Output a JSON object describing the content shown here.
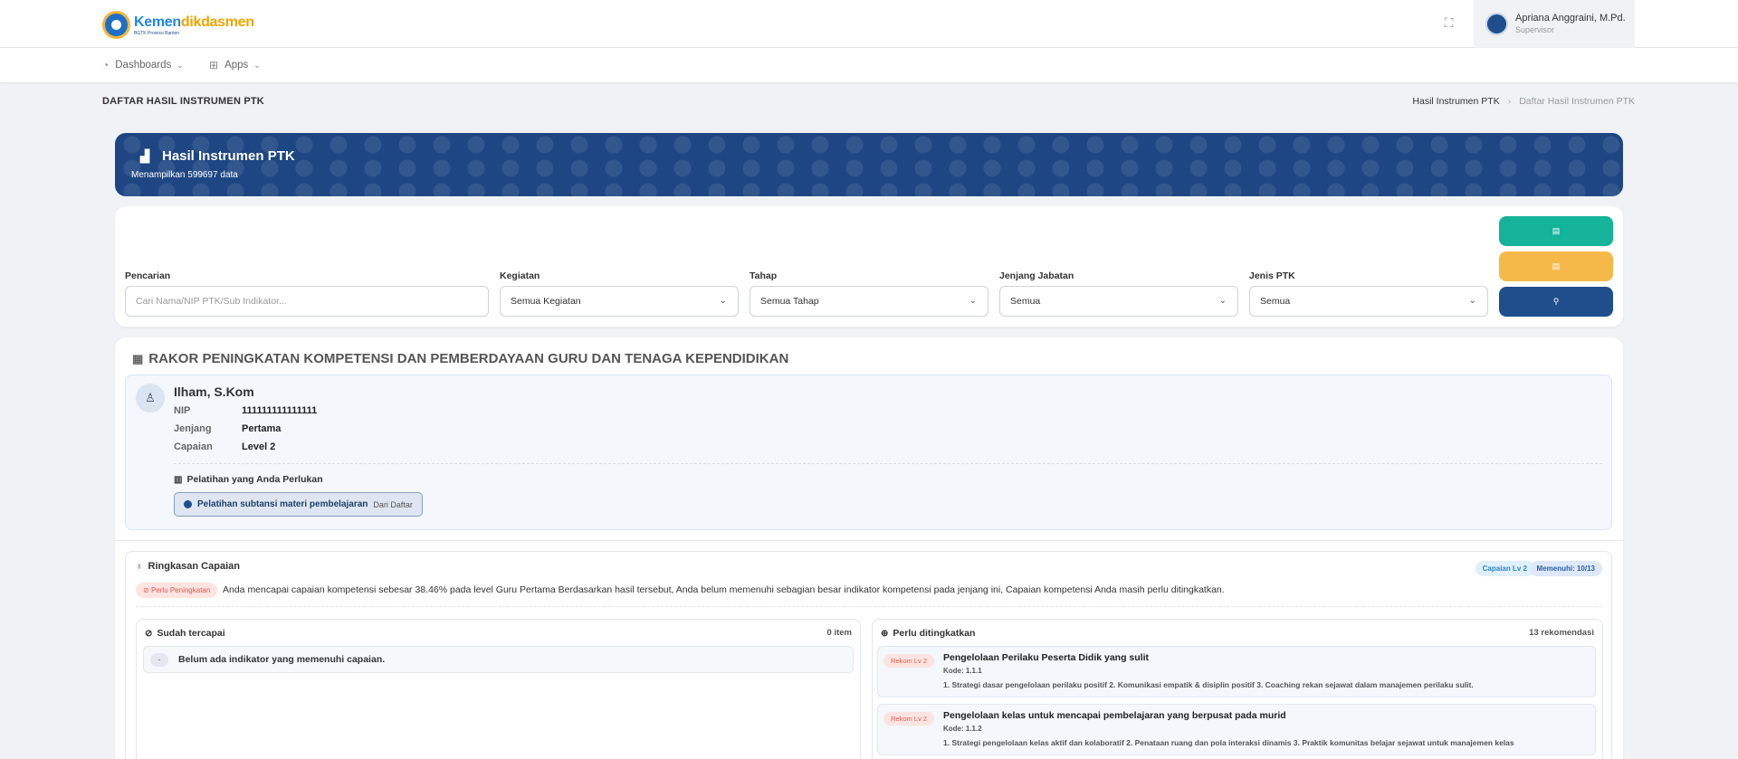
{
  "brand": {
    "name_a": "Kemen",
    "name_b": "dikdasmen",
    "subtitle": "BGTK Provinsi Banten"
  },
  "user": {
    "name": "Apriana Anggraini, M.Pd.",
    "role": "Supervisor"
  },
  "nav": {
    "dashboards": "Dashboards",
    "apps": "Apps"
  },
  "page": {
    "title": "DAFTAR HASIL INSTRUMEN PTK"
  },
  "breadcrumb": {
    "item1": "Hasil Instrumen PTK",
    "item2": "Daftar Hasil Instrumen PTK"
  },
  "hero": {
    "title": "Hasil Instrumen PTK",
    "subtitle": "Menampilkan 599697 data"
  },
  "filters": {
    "search_label": "Pencarian",
    "search_placeholder": "Cari Nama/NIP PTK/Sub Indikator...",
    "kegiatan_label": "Kegiatan",
    "kegiatan_value": "Semua Kegiatan",
    "tahap_label": "Tahap",
    "tahap_value": "Semua Tahap",
    "jenjang_label": "Jenjang Jabatan",
    "jenjang_value": "Semua",
    "jenis_label": "Jenis PTK",
    "jenis_value": "Semua"
  },
  "colors": {
    "btn_excel": "#14b39a",
    "btn_pdf": "#f5b94a",
    "btn_search": "#1f4e8c",
    "hero": "#1e4683"
  },
  "section": {
    "title": "RAKOR PENINGKATAN KOMPETENSI DAN PEMBERDAYAAN GURU DAN TENAGA KEPENDIDIKAN"
  },
  "profile": {
    "name": "Ilham, S.Kom",
    "nip_label": "NIP",
    "nip": "111111111111111",
    "jenjang_label": "Jenjang",
    "jenjang": "Pertama",
    "capaian_label": "Capaian",
    "capaian": "Level 2",
    "training_title": "Pelatihan yang Anda Perlukan",
    "training_item": "Pelatihan subtansi materi pembelajaran",
    "training_source": "Dari Daftar"
  },
  "summary": {
    "title": "Ringkasan Capaian",
    "chip_capaian": "Capaian Lv 2",
    "chip_memenuhi": "Memenuhi: 10/13",
    "warning": "Perlu Peningkatan",
    "text": "Anda mencapai capaian kompetensi sebesar 38.46% pada level Guru Pertama Berdasarkan hasil tersebut, Anda belum memenuhi sebagian besar indikator kompetensi pada jenjang ini, Capaian kompetensi Anda masih perlu ditingkatkan."
  },
  "achieved": {
    "title": "Sudah tercapai",
    "count": "0 item",
    "empty_marker": "-",
    "empty": "Belum ada indikator yang memenuhi capaian."
  },
  "improve": {
    "title": "Perlu ditingkatkan",
    "count": "13 rekomendasi",
    "items": [
      {
        "level": "Rekom Lv 2",
        "title": "Pengelolaan Perilaku Peserta Didik yang sulit",
        "code": "Kode: 1.1.1",
        "desc": "1. Strategi dasar pengelolaan perilaku positif 2. Komunikasi empatik & disiplin positif 3. Coaching rekan sejawat dalam manajemen perilaku sulit."
      },
      {
        "level": "Rekom Lv 2",
        "title": "Pengelolaan kelas untuk mencapai pembelajaran yang berpusat pada murid",
        "code": "Kode: 1.1.2",
        "desc": "1. Strategi pengelolaan kelas aktif dan kolaboratif 2. Penataan ruang dan pola interaksi dinamis 3. Praktik komunitas belajar sejawat untuk manajemen kelas"
      }
    ]
  }
}
